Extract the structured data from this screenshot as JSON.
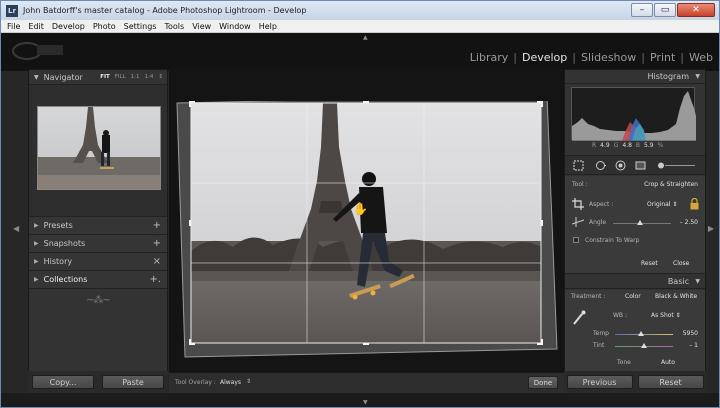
{
  "window": {
    "title": "John Batdorff's master catalog - Adobe Photoshop Lightroom - Develop",
    "app_icon": "Lr",
    "controls": [
      "–",
      "▭",
      "✕"
    ]
  },
  "menu": [
    "File",
    "Edit",
    "Develop",
    "Photo",
    "Settings",
    "Tools",
    "View",
    "Window",
    "Help"
  ],
  "modules": {
    "items": [
      "Library",
      "Develop",
      "Slideshow",
      "Print",
      "Web"
    ],
    "active": "Develop",
    "separator": "|"
  },
  "left_panel": {
    "navigator": {
      "title": "Navigator",
      "zoom_options": [
        "FIT",
        "FILL",
        "1:1",
        "1:4"
      ],
      "zoom_selected": "FIT",
      "zoom_caret": "⇕"
    },
    "sections": [
      {
        "label": "Presets",
        "action": "+"
      },
      {
        "label": "Snapshots",
        "action": "+"
      },
      {
        "label": "History",
        "action": "×"
      },
      {
        "label": "Collections",
        "action": "+."
      }
    ],
    "ornament": "~⁂~",
    "buttons": {
      "copy": "Copy...",
      "paste": "Paste"
    }
  },
  "toolbar": {
    "overlay_label": "Tool Overlay :",
    "overlay_value": "Always",
    "overlay_caret": "⇕",
    "done": "Done"
  },
  "right_panel": {
    "histogram": {
      "title": "Histogram",
      "readout": {
        "r_label": "R",
        "r_value": "4.9",
        "g_label": "G",
        "g_value": "4.8",
        "b_label": "B",
        "b_value": "5.9",
        "unit": "%"
      }
    },
    "crop": {
      "tool_label": "Tool :",
      "tool_value": "Crop & Straighten",
      "aspect_label": "Aspect :",
      "aspect_value": "Original ⇕",
      "angle_label": "Angle",
      "angle_value": "– 2.50",
      "angle_fraction": 0.46,
      "constrain_label": "Constrain To Warp",
      "reset": "Reset",
      "close": "Close"
    },
    "basic": {
      "title": "Basic",
      "treatment_label": "Treatment :",
      "treatment_color": "Color",
      "treatment_bw": "Black & White",
      "wb_label": "WB :",
      "wb_value": "As Shot ⇕",
      "temp_label": "Temp",
      "temp_value": "5950",
      "temp_fraction": 0.45,
      "tint_label": "Tint",
      "tint_value": "– 1",
      "tint_fraction": 0.5,
      "tone_label": "Tone",
      "auto_label": "Auto"
    },
    "buttons": {
      "previous": "Previous",
      "reset": "Reset"
    }
  },
  "colors": {
    "accent_title_bar": "#c6d4e6",
    "panel_bg": "#333333",
    "close_button": "#c7422c",
    "lock_icon": "#d8a73a"
  },
  "icons": {
    "side_arrow_left": "◀",
    "side_arrow_right": "▶",
    "top_arrow": "▲",
    "bottom_arrow": "▼",
    "expand_triangle": "▶",
    "collapse_triangle": "▼"
  }
}
